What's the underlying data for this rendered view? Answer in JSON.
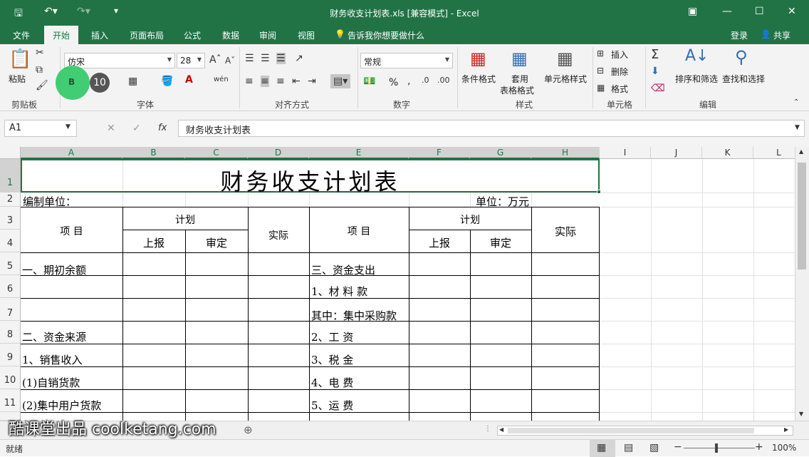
{
  "titlebar": {
    "title": "财务收支计划表.xls  [兼容模式] - Excel",
    "save_icon": "save-icon",
    "undo_icon": "undo-icon",
    "redo_icon": "redo-icon"
  },
  "tabs": {
    "file": "文件",
    "home": "开始",
    "insert": "插入",
    "layout": "页面布局",
    "formulas": "公式",
    "data": "数据",
    "review": "审阅",
    "view": "视图",
    "tellme": "告诉我你想要做什么",
    "login": "登录",
    "share": "共享"
  },
  "ribbon": {
    "paste": "粘贴",
    "clipboard": "剪贴板",
    "font_name": "仿宋",
    "font_size": "28",
    "font_group": "字体",
    "bold": "B",
    "hint_number": "10",
    "align_group": "对齐方式",
    "number_format": "常规",
    "number_group": "数字",
    "percent": "%",
    "cond_format": "条件格式",
    "table_format_1": "套用",
    "table_format_2": "表格格式",
    "cell_style": "单元格样式",
    "style_group": "样式",
    "insert": "插入",
    "delete": "删除",
    "format": "格式",
    "cells_group": "单元格",
    "sort_filter": "排序和筛选",
    "find_select": "查找和选择",
    "edit_group": "编辑"
  },
  "formula_bar": {
    "name_box": "A1",
    "fx": "fx",
    "content": "财务收支计划表"
  },
  "grid": {
    "columns": [
      "A",
      "B",
      "C",
      "D",
      "E",
      "F",
      "G",
      "H",
      "I",
      "J",
      "K",
      "L"
    ],
    "rows": [
      "1",
      "2",
      "3",
      "4",
      "5",
      "6",
      "7",
      "8",
      "9",
      "10",
      "11"
    ],
    "title": "财务收支计划表",
    "r2_left": "编制单位：",
    "r2_right": "单位：万元",
    "hdr_item": "项          目",
    "hdr_plan": "计划",
    "hdr_report": "上报",
    "hdr_approve": "审定",
    "hdr_actual": "实际",
    "left_items": [
      "一、期初余额",
      "",
      "",
      "二、资金来源",
      "1、销售收入",
      "(1)自销货款",
      "(2)集中用户货款"
    ],
    "right_items": [
      "三、资金支出",
      "1、材 料 款",
      "其中：集中采购款",
      "2、工     资",
      "3、税     金",
      "4、电     费",
      "5、运     费"
    ]
  },
  "sheetbar": {
    "watermark": "酷课堂出品 coolketang.com"
  },
  "status": {
    "ready": "就绪",
    "zoom": "100%"
  }
}
